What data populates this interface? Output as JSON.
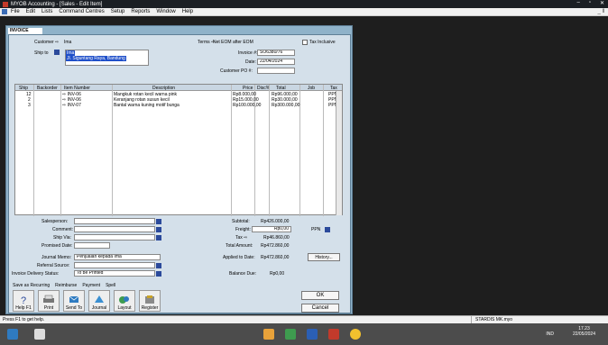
{
  "titlebar": {
    "title": "MYOB Accounting - [Sales - Edit Item]",
    "minimize": "–",
    "restore": "▫",
    "close": "✕"
  },
  "menu": [
    "File",
    "Edit",
    "Lists",
    "Command Centres",
    "Setup",
    "Reports",
    "Window",
    "Help"
  ],
  "menu_corner": "_ ‖",
  "invoice": {
    "tab": "INVOICE",
    "customer_label": "Customer ⇨",
    "customer_value": "Ima",
    "terms_label": "Terms ⇨",
    "terms_value": "Net EOM after EOM",
    "tax_inclusive_label": "Tax Inclusive",
    "ship_to_label": "Ship to",
    "ship_to_lines": [
      "Ima",
      "Jl. Siguntang Raya, Bandung"
    ],
    "invoice_no_label": "Invoice #:",
    "invoice_no": "SO6380/76",
    "date_label": "Date:",
    "date": "22/04/2024",
    "customer_po_label": "Customer PO #:",
    "customer_po": ""
  },
  "table": {
    "headers": [
      "Ship",
      "Backorder",
      "Item Number",
      "Description",
      "Price",
      "Disc%",
      "Total",
      "Job",
      "Tax"
    ],
    "rows": [
      {
        "ship": "12",
        "backorder": "",
        "item": "⇨ INV-06",
        "desc": "Mangkuk rotan kecil warna pink",
        "price": "Rp8.000,00",
        "disc": "",
        "total": "Rp96.000,00",
        "job": "",
        "tax": "PPN"
      },
      {
        "ship": "2",
        "backorder": "",
        "item": "⇨ INV-06",
        "desc": "Keranjang rotan susun kecil",
        "price": "Rp15.000,00",
        "disc": "",
        "total": "Rp30.000,00",
        "job": "",
        "tax": "PPN"
      },
      {
        "ship": "3",
        "backorder": "",
        "item": "⇨ INV-07",
        "desc": "Bantal warna kuning motif bunga",
        "price": "Rp100.000,00",
        "disc": "",
        "total": "Rp300.000,00",
        "job": "",
        "tax": "PPN"
      }
    ]
  },
  "footer": {
    "salesperson_label": "Salesperson:",
    "comment_label": "Comment:",
    "ship_via_label": "Ship Via:",
    "promised_date_label": "Promised Date:",
    "journal_memo_label": "Journal Memo:",
    "journal_memo": "Penjualan kepada Ima",
    "referral_label": "Referral Source:",
    "delivery_label": "Invoice Delivery Status:",
    "delivery_value": "To be Printed",
    "subtotal_label": "Subtotal:",
    "subtotal": "Rp426.000,00",
    "freight_label": "Freight:",
    "freight": "Rp0,00",
    "freight_tax": "PPN",
    "tax_label": "Tax ⇨",
    "tax": "Rp46.860,00",
    "total_label": "Total Amount:",
    "total": "Rp472.860,00",
    "applied_label": "Applied to Date:",
    "applied": "Rp472.860,00",
    "balance_label": "Balance Due:",
    "balance": "Rp0,00",
    "history_btn": "History..."
  },
  "actions": [
    "Save as Recurring",
    "Reimburse",
    "Payment",
    "Spell"
  ],
  "big_buttons": [
    "Help F1",
    "Print",
    "Send To",
    "Journal",
    "Layout",
    "Register"
  ],
  "ok": "OK",
  "cancel": "Cancel",
  "status_left": "Press F1 to get help.",
  "status_right": "STARDIS MK.myo",
  "clock": {
    "time": "17.23",
    "date": "22/05/2024",
    "lang": "IND"
  }
}
